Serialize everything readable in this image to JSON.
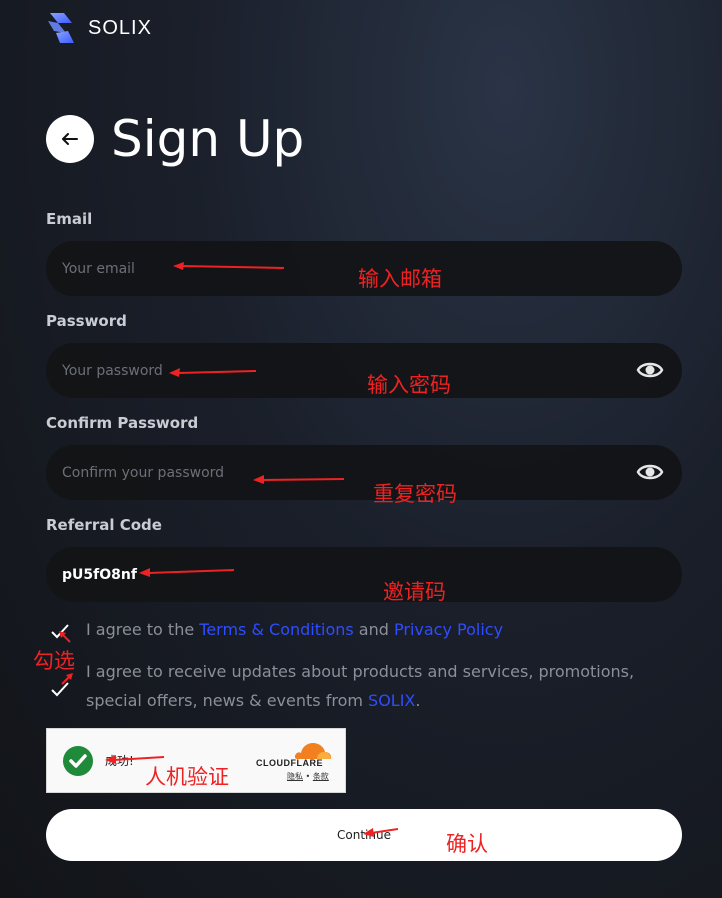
{
  "brand": {
    "name": "SOLIX"
  },
  "header": {
    "title": "Sign Up"
  },
  "form": {
    "email": {
      "label": "Email",
      "placeholder": "Your email",
      "value": ""
    },
    "password": {
      "label": "Password",
      "placeholder": "Your password",
      "value": ""
    },
    "confirm_password": {
      "label": "Confirm Password",
      "placeholder": "Confirm your password",
      "value": ""
    },
    "referral": {
      "label": "Referral Code",
      "placeholder": "",
      "value": "pU5fO8nf"
    }
  },
  "agreements": {
    "terms": {
      "checked": true,
      "prefix": "I agree to the ",
      "terms_link": "Terms & Conditions",
      "middle": " and ",
      "privacy_link": "Privacy Policy"
    },
    "updates": {
      "checked": true,
      "text": "I agree to receive updates about products and services, promotions, special offers, news & events from ",
      "brand_link": "SOLIX",
      "suffix": "."
    }
  },
  "captcha": {
    "status": "成功!",
    "provider": "CLOUDFLARE",
    "privacy_link": "隐私",
    "separator": " • ",
    "terms_link": "条款",
    "verified": true
  },
  "submit": {
    "label": "Continue"
  },
  "annotations": {
    "email": "输入邮箱",
    "password": "输入密码",
    "confirm": "重复密码",
    "referral": "邀请码",
    "checkboxes": "勾选",
    "captcha": "人机验证",
    "submit": "确认"
  },
  "colors": {
    "background": "#1a1f2a",
    "field_bg": "#121316",
    "link": "#2f4dff",
    "annotation": "#ee2222",
    "captcha_success": "#1e8a3a",
    "cloudflare_orange": "#f38020"
  }
}
